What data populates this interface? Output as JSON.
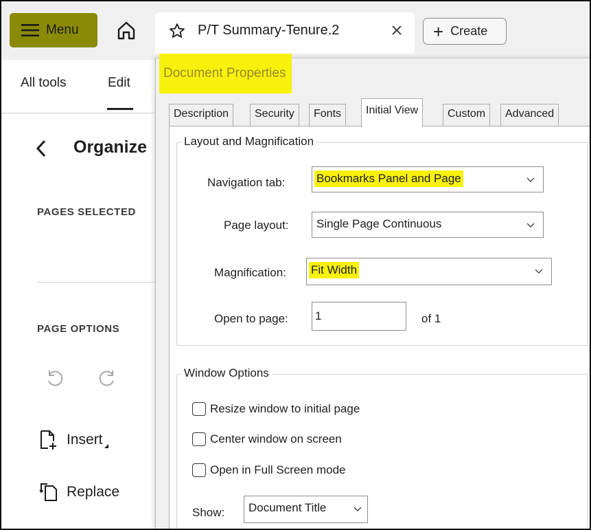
{
  "topbar": {
    "menu_label": "Menu",
    "tab_title": "P/T Summary-Tenure.2",
    "create_label": "Create"
  },
  "left_panel": {
    "tabs": [
      "All tools",
      "Edit"
    ],
    "title": "Organize",
    "pages_selected_label": "PAGES SELECTED",
    "page_options_label": "PAGE OPTIONS",
    "tools": [
      {
        "label": "Insert",
        "icon": "insert-page-icon"
      },
      {
        "label": "Replace",
        "icon": "replace-page-icon"
      }
    ]
  },
  "dialog": {
    "title": "Document Properties",
    "tabs": [
      "Description",
      "Security",
      "Fonts",
      "Initial View",
      "Custom",
      "Advanced"
    ],
    "active_tab": "Initial View",
    "layout_group": {
      "legend": "Layout and Magnification",
      "navigation_tab": {
        "label": "Navigation tab:",
        "value": "Bookmarks Panel and Page"
      },
      "page_layout": {
        "label": "Page layout:",
        "value": "Single Page Continuous"
      },
      "magnification": {
        "label": "Magnification:",
        "value": "Fit Width"
      },
      "open_to_page": {
        "label": "Open to page:",
        "value": "1",
        "of_text": "of 1"
      }
    },
    "window_group": {
      "legend": "Window Options",
      "checkboxes": [
        {
          "label": "Resize window to initial page",
          "checked": false
        },
        {
          "label": "Center window on screen",
          "checked": false
        },
        {
          "label": "Open in Full Screen mode",
          "checked": false
        }
      ],
      "show": {
        "label": "Show:",
        "value": "Document Title"
      }
    }
  },
  "colors": {
    "highlight": "#f7f10c",
    "menu_highlight": "#8a8a07"
  }
}
